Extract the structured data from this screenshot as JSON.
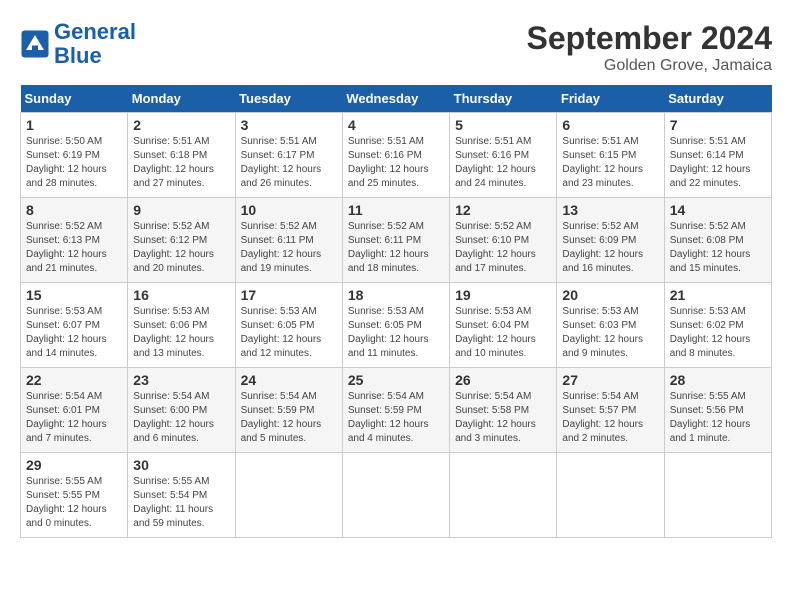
{
  "header": {
    "logo_line1": "General",
    "logo_line2": "Blue",
    "month_title": "September 2024",
    "location": "Golden Grove, Jamaica"
  },
  "weekdays": [
    "Sunday",
    "Monday",
    "Tuesday",
    "Wednesday",
    "Thursday",
    "Friday",
    "Saturday"
  ],
  "weeks": [
    [
      {
        "day": "1",
        "sunrise": "5:50 AM",
        "sunset": "6:19 PM",
        "daylight": "12 hours and 28 minutes."
      },
      {
        "day": "2",
        "sunrise": "5:51 AM",
        "sunset": "6:18 PM",
        "daylight": "12 hours and 27 minutes."
      },
      {
        "day": "3",
        "sunrise": "5:51 AM",
        "sunset": "6:17 PM",
        "daylight": "12 hours and 26 minutes."
      },
      {
        "day": "4",
        "sunrise": "5:51 AM",
        "sunset": "6:16 PM",
        "daylight": "12 hours and 25 minutes."
      },
      {
        "day": "5",
        "sunrise": "5:51 AM",
        "sunset": "6:16 PM",
        "daylight": "12 hours and 24 minutes."
      },
      {
        "day": "6",
        "sunrise": "5:51 AM",
        "sunset": "6:15 PM",
        "daylight": "12 hours and 23 minutes."
      },
      {
        "day": "7",
        "sunrise": "5:51 AM",
        "sunset": "6:14 PM",
        "daylight": "12 hours and 22 minutes."
      }
    ],
    [
      {
        "day": "8",
        "sunrise": "5:52 AM",
        "sunset": "6:13 PM",
        "daylight": "12 hours and 21 minutes."
      },
      {
        "day": "9",
        "sunrise": "5:52 AM",
        "sunset": "6:12 PM",
        "daylight": "12 hours and 20 minutes."
      },
      {
        "day": "10",
        "sunrise": "5:52 AM",
        "sunset": "6:11 PM",
        "daylight": "12 hours and 19 minutes."
      },
      {
        "day": "11",
        "sunrise": "5:52 AM",
        "sunset": "6:11 PM",
        "daylight": "12 hours and 18 minutes."
      },
      {
        "day": "12",
        "sunrise": "5:52 AM",
        "sunset": "6:10 PM",
        "daylight": "12 hours and 17 minutes."
      },
      {
        "day": "13",
        "sunrise": "5:52 AM",
        "sunset": "6:09 PM",
        "daylight": "12 hours and 16 minutes."
      },
      {
        "day": "14",
        "sunrise": "5:52 AM",
        "sunset": "6:08 PM",
        "daylight": "12 hours and 15 minutes."
      }
    ],
    [
      {
        "day": "15",
        "sunrise": "5:53 AM",
        "sunset": "6:07 PM",
        "daylight": "12 hours and 14 minutes."
      },
      {
        "day": "16",
        "sunrise": "5:53 AM",
        "sunset": "6:06 PM",
        "daylight": "12 hours and 13 minutes."
      },
      {
        "day": "17",
        "sunrise": "5:53 AM",
        "sunset": "6:05 PM",
        "daylight": "12 hours and 12 minutes."
      },
      {
        "day": "18",
        "sunrise": "5:53 AM",
        "sunset": "6:05 PM",
        "daylight": "12 hours and 11 minutes."
      },
      {
        "day": "19",
        "sunrise": "5:53 AM",
        "sunset": "6:04 PM",
        "daylight": "12 hours and 10 minutes."
      },
      {
        "day": "20",
        "sunrise": "5:53 AM",
        "sunset": "6:03 PM",
        "daylight": "12 hours and 9 minutes."
      },
      {
        "day": "21",
        "sunrise": "5:53 AM",
        "sunset": "6:02 PM",
        "daylight": "12 hours and 8 minutes."
      }
    ],
    [
      {
        "day": "22",
        "sunrise": "5:54 AM",
        "sunset": "6:01 PM",
        "daylight": "12 hours and 7 minutes."
      },
      {
        "day": "23",
        "sunrise": "5:54 AM",
        "sunset": "6:00 PM",
        "daylight": "12 hours and 6 minutes."
      },
      {
        "day": "24",
        "sunrise": "5:54 AM",
        "sunset": "5:59 PM",
        "daylight": "12 hours and 5 minutes."
      },
      {
        "day": "25",
        "sunrise": "5:54 AM",
        "sunset": "5:59 PM",
        "daylight": "12 hours and 4 minutes."
      },
      {
        "day": "26",
        "sunrise": "5:54 AM",
        "sunset": "5:58 PM",
        "daylight": "12 hours and 3 minutes."
      },
      {
        "day": "27",
        "sunrise": "5:54 AM",
        "sunset": "5:57 PM",
        "daylight": "12 hours and 2 minutes."
      },
      {
        "day": "28",
        "sunrise": "5:55 AM",
        "sunset": "5:56 PM",
        "daylight": "12 hours and 1 minute."
      }
    ],
    [
      {
        "day": "29",
        "sunrise": "5:55 AM",
        "sunset": "5:55 PM",
        "daylight": "12 hours and 0 minutes."
      },
      {
        "day": "30",
        "sunrise": "5:55 AM",
        "sunset": "5:54 PM",
        "daylight": "11 hours and 59 minutes."
      },
      null,
      null,
      null,
      null,
      null
    ]
  ]
}
